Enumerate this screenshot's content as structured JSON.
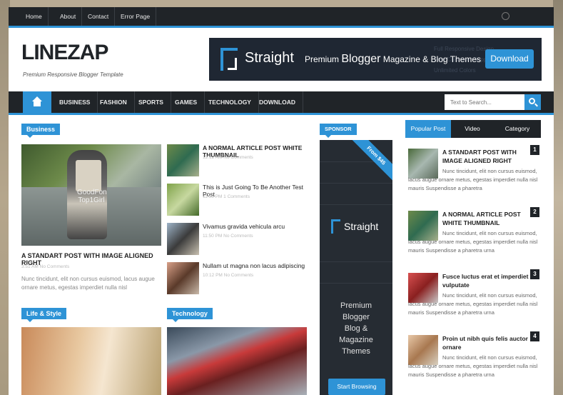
{
  "topnav": {
    "items": [
      "Home",
      "About",
      "Contact",
      "Error Page"
    ]
  },
  "header": {
    "logo": "LINEZAP",
    "tagline": "Premium Responsive Blogger Template",
    "banner": {
      "brand": "Straight",
      "prefix": "Premium",
      "highlight": "Blogger",
      "suffix": "Magazine & Blog Themes",
      "button": "Download",
      "ghost_lines": [
        "Full Responsive Design",
        "Free Customer Support",
        "Unlimited Colors"
      ]
    }
  },
  "mainnav": {
    "items": [
      "BUSINESS",
      "FASHION",
      "SPORTS",
      "GAMES",
      "TECHNOLOGY",
      "DOWNLOAD"
    ],
    "search_placeholder": "Text to Search..."
  },
  "business": {
    "label": "Business",
    "featured": {
      "title": "A STANDART POST WITH IMAGE ALIGNED RIGHT",
      "meta": "3:51 AM   No Comments",
      "excerpt": "Nunc tincidunt, elit non cursus euismod, lacus augue ornare metus, egestas imperdiet nulla nisl",
      "watermark": "GoodFon Top1Girl"
    },
    "list": [
      {
        "title": "A NORMAL ARTICLE POST WHITE THUMBNAIL",
        "meta": "12:12 AM   No Comments"
      },
      {
        "title": "This is Just Going To Be Another Test Post",
        "meta": "11:55 PM   1 Comments"
      },
      {
        "title": "Vivamus gravida vehicula arcu",
        "meta": "11:50 PM   No Comments"
      },
      {
        "title": "Nullam ut magna non lacus adipiscing",
        "meta": "10:12 PM   No Comments"
      }
    ]
  },
  "sections": {
    "left": "Life & Style",
    "right": "Technology"
  },
  "sponsor": {
    "label": "SPONSOR",
    "ribbon": "From $45",
    "brand": "Straight",
    "lines": [
      "Premium",
      "Blogger",
      "Blog &",
      "Magazine",
      "Themes"
    ],
    "button": "Start Browsing"
  },
  "sidebar": {
    "tabs": [
      "Popular Post",
      "Video",
      "Category"
    ],
    "posts": [
      {
        "num": "1",
        "title": "A STANDART POST WITH IMAGE ALIGNED RIGHT",
        "excerpt": "Nunc tincidunt, elit non cursus euismod, lacus augue ornare metus, egestas imperdiet nulla nisl mauris Suspendisse a pharetra"
      },
      {
        "num": "2",
        "title": "A NORMAL ARTICLE POST WHITE THUMBNAIL",
        "excerpt": "Nunc tincidunt, elit non cursus euismod, lacus augue ornare metus, egestas imperdiet nulla nisl mauris Suspendisse a pharetra urna"
      },
      {
        "num": "3",
        "title": "Fusce luctus erat et imperdiet vulputate",
        "excerpt": "Nunc tincidunt, elit non cursus euismod, lacus augue ornare metus, egestas imperdiet nulla nisl mauris Suspendisse a pharetra urna"
      },
      {
        "num": "4",
        "title": "Proin ut nibh quis felis auctor ornare",
        "excerpt": "Nunc tincidunt, elit non cursus euismod, lacus augue ornare metus, egestas imperdiet nulla nisl mauris Suspendisse a pharetra urna"
      }
    ]
  },
  "colors": {
    "accent": "#2e93d6",
    "dark": "#202428"
  }
}
